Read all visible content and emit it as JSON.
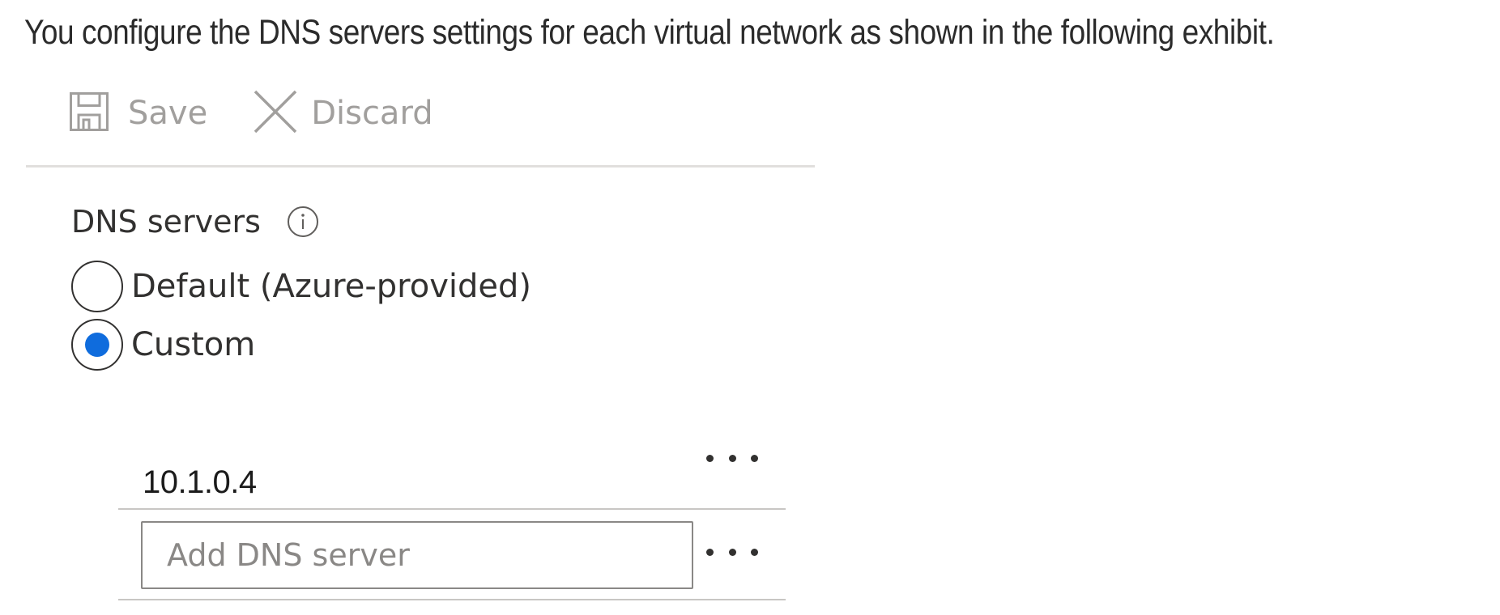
{
  "intro_text": "You configure the DNS servers settings for each virtual network as shown in the following exhibit.",
  "toolbar": {
    "save_label": "Save",
    "save_icon": "save-icon",
    "discard_label": "Discard",
    "discard_icon": "close-icon"
  },
  "dns_servers": {
    "label": "DNS servers",
    "info_icon": "info-icon",
    "options": [
      {
        "label": "Default (Azure-provided)",
        "selected": false
      },
      {
        "label": "Custom",
        "selected": true
      }
    ],
    "entries": [
      "10.1.0.4"
    ],
    "add_placeholder": "Add DNS server",
    "add_value": "",
    "more_icon": "more-icon"
  },
  "colors": {
    "accent": "#0f6cdd",
    "disabled_text": "#a19f9d",
    "text": "#323130",
    "divider": "#e1dfdd"
  }
}
